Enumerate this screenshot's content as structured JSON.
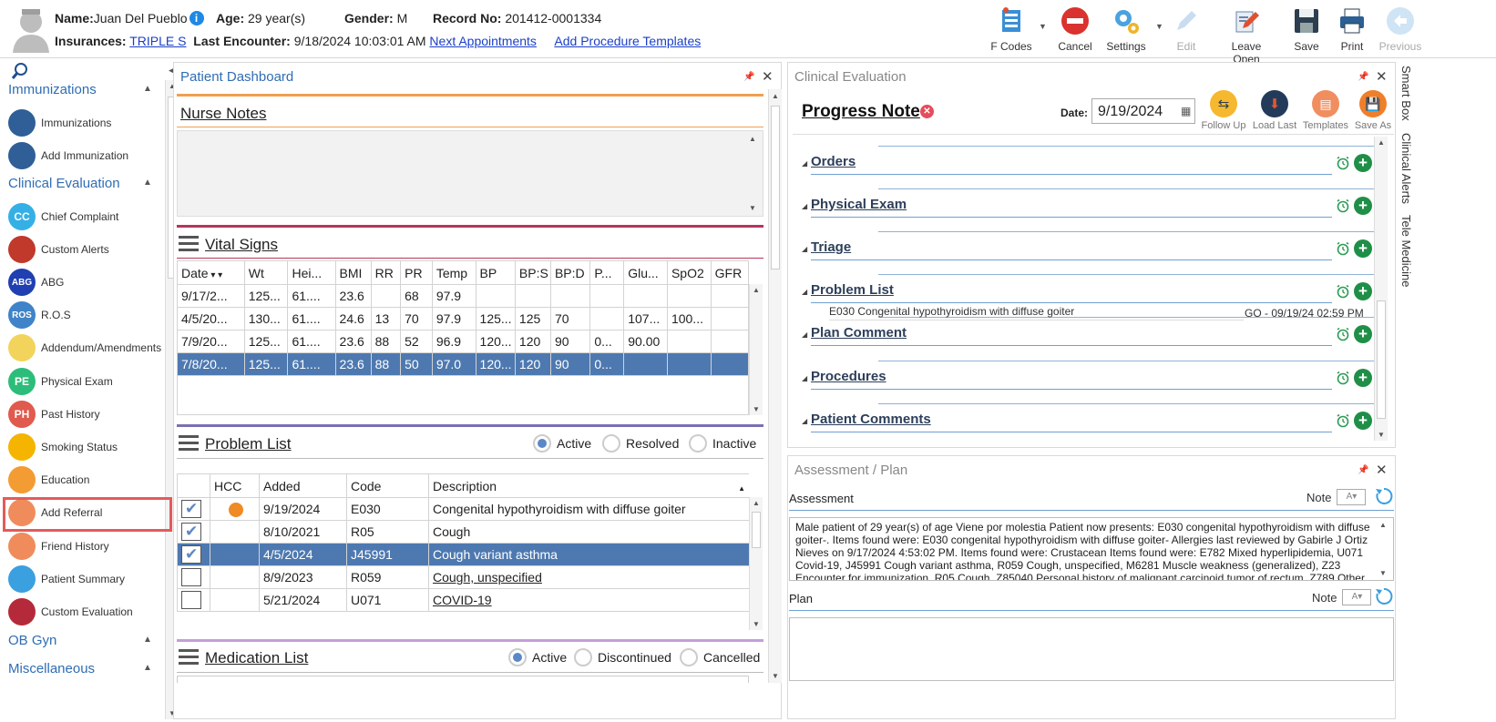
{
  "header": {
    "name_label": "Name:",
    "name_value": "Juan Del Pueblo",
    "age_label": "Age:",
    "age_value": "29 year(s)",
    "gender_label": "Gender:",
    "gender_value": "M",
    "record_label": "Record No:",
    "record_value": "201412-0001334",
    "insurances_label": "Insurances:",
    "insurances_value": "TRIPLE S",
    "last_encounter_label": "Last Encounter:",
    "last_encounter_value": "9/18/2024 10:03:01 AM",
    "next_appointments": "Next Appointments",
    "add_procedure_templates": "Add Procedure Templates"
  },
  "toolbar": {
    "fcodes": "F Codes",
    "cancel": "Cancel",
    "settings": "Settings",
    "edit": "Edit",
    "leave_open": "Leave Open",
    "save": "Save",
    "print": "Print",
    "previous": "Previous"
  },
  "sidebar": {
    "sections": {
      "immunizations": "Immunizations",
      "clinical_evaluation": "Clinical Evaluation",
      "ob_gyn": "OB Gyn",
      "miscellaneous": "Miscellaneous"
    },
    "items": [
      {
        "label": "Immunizations",
        "icon": "syringe-icon",
        "abbr": "",
        "color": "#2f5f96"
      },
      {
        "label": "Add Immunization",
        "icon": "syringe-icon",
        "abbr": "",
        "color": "#2f5f96"
      },
      {
        "label": "Chief Complaint",
        "icon": "cc-icon",
        "abbr": "CC",
        "color": "#35b0e6"
      },
      {
        "label": "Custom Alerts",
        "icon": "alert-icon",
        "abbr": "",
        "color": "#c0392b"
      },
      {
        "label": "ABG",
        "icon": "abg-icon",
        "abbr": "ABG",
        "color": "#1f3fb2"
      },
      {
        "label": "R.O.S",
        "icon": "ros-icon",
        "abbr": "ROS",
        "color": "#3f83c8"
      },
      {
        "label": "Addendum/Amendments",
        "icon": "document-icon",
        "abbr": "",
        "color": "#f2d45c"
      },
      {
        "label": "Physical Exam",
        "icon": "pe-icon",
        "abbr": "PE",
        "color": "#2dbd7a"
      },
      {
        "label": "Past History",
        "icon": "ph-icon",
        "abbr": "PH",
        "color": "#e05a4e"
      },
      {
        "label": "Smoking Status",
        "icon": "no-smoking-icon",
        "abbr": "",
        "color": "#f4b400"
      },
      {
        "label": "Education",
        "icon": "education-icon",
        "abbr": "",
        "color": "#f39c34"
      },
      {
        "label": "Add Referral",
        "icon": "referral-icon",
        "abbr": "",
        "color": "#f08c5c"
      },
      {
        "label": "Friend History",
        "icon": "friends-icon",
        "abbr": "",
        "color": "#f08c5c"
      },
      {
        "label": "Patient Summary",
        "icon": "summary-icon",
        "abbr": "",
        "color": "#3aa0e0"
      },
      {
        "label": "Custom Evaluation",
        "icon": "stethoscope-icon",
        "abbr": "",
        "color": "#b52a3a"
      }
    ]
  },
  "dashboard": {
    "title": "Patient Dashboard",
    "nurse_notes": "Nurse Notes",
    "vital_signs": "Vital Signs",
    "vitals_headers": [
      "Date",
      "Wt",
      "Hei...",
      "BMI",
      "RR",
      "PR",
      "Temp",
      "BP",
      "BP:S",
      "BP:D",
      "P...",
      "Glu...",
      "SpO2",
      "GFR"
    ],
    "vitals_rows": [
      [
        "9/17/2...",
        "125...",
        "61....",
        "23.6",
        "",
        "68",
        "97.9",
        "",
        "",
        "",
        "",
        "",
        "",
        ""
      ],
      [
        "4/5/20...",
        "130...",
        "61....",
        "24.6",
        "13",
        "70",
        "97.9",
        "125...",
        "125",
        "70",
        "",
        "107...",
        "100...",
        ""
      ],
      [
        "7/9/20...",
        "125...",
        "61....",
        "23.6",
        "88",
        "52",
        "96.9",
        "120...",
        "120",
        "90",
        "0...",
        "90.00",
        "",
        ""
      ],
      [
        "7/8/20...",
        "125...",
        "61....",
        "23.6",
        "88",
        "50",
        "97.0",
        "120...",
        "120",
        "90",
        "0...",
        "",
        "",
        ""
      ]
    ],
    "problem_list": "Problem List",
    "problem_filters": {
      "active": "Active",
      "resolved": "Resolved",
      "inactive": "Inactive"
    },
    "problem_headers": [
      "",
      "HCC",
      "Added",
      "Code",
      "Description"
    ],
    "problem_rows": [
      {
        "checked": true,
        "hcc": true,
        "added": "9/19/2024",
        "code": "E030",
        "desc": "Congenital hypothyroidism with diffuse goiter",
        "link": false
      },
      {
        "checked": true,
        "hcc": false,
        "added": "8/10/2021",
        "code": "R05",
        "desc": "Cough",
        "link": false
      },
      {
        "checked": true,
        "hcc": false,
        "added": "4/5/2024",
        "code": "J45991",
        "desc": "Cough variant asthma",
        "link": false
      },
      {
        "checked": false,
        "hcc": false,
        "added": "8/9/2023",
        "code": "R059",
        "desc": "Cough, unspecified",
        "link": true
      },
      {
        "checked": false,
        "hcc": false,
        "added": "5/21/2024",
        "code": "U071",
        "desc": "COVID-19",
        "link": true
      }
    ],
    "medication_list": "Medication List",
    "med_filters": {
      "active": "Active",
      "discontinued": "Discontinued",
      "cancelled": "Cancelled"
    }
  },
  "clinical": {
    "title": "Clinical Evaluation",
    "note_title": "Progress Note",
    "date_label": "Date:",
    "date_value": "9/19/2024",
    "tools": {
      "follow_up": "Follow Up",
      "load_last": "Load Last",
      "templates": "Templates",
      "save_as": "Save As"
    },
    "sections": [
      "Orders",
      "Physical Exam",
      "Triage",
      "Problem List",
      "Plan Comment",
      "Procedures",
      "Patient Comments"
    ],
    "problem_entry": "E030 Congenital hypothyroidism with diffuse goiter",
    "problem_entry_meta": "GO - 09/19/24 02:59 PM"
  },
  "assessment": {
    "title": "Assessment / Plan",
    "assessment_label": "Assessment",
    "plan_label": "Plan",
    "note_label": "Note",
    "assessment_text": "Male patient of 29 year(s) of age Viene por molestia Patient now presents: E030 congenital hypothyroidism with diffuse goiter-. Items found were: E030 congenital hypothyroidism with diffuse goiter-   Allergies last reviewed by Gabirle J Ortiz Nieves on 9/17/2024 4:53:02 PM.    Items found were:  Crustacean  Items found were:  E782 Mixed hyperlipidemia, U071 Covid-19, J45991 Cough variant asthma, R059 Cough, unspecified, M6281 Muscle weakness (generalized), Z23 Encounter for immunization, R05 Cough, Z85040 Personal history of malignant carcinoid tumor of rectum, Z789 Other"
  },
  "right_tabs": [
    "Smart Box",
    "Clinical Alerts",
    "Tele Medicine"
  ]
}
